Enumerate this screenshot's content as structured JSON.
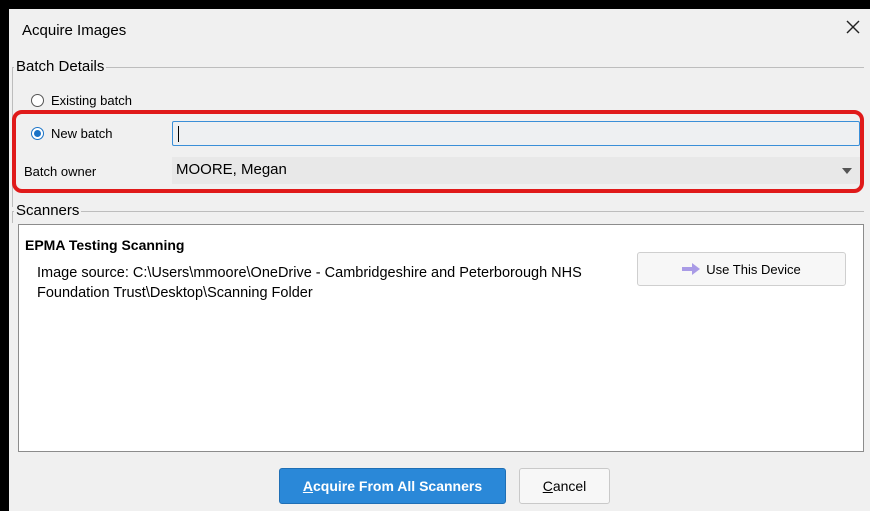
{
  "dialog": {
    "title": "Acquire Images",
    "close_icon": "close-icon"
  },
  "batch_details": {
    "group_label": "Batch Details",
    "existing_batch_label": "Existing batch",
    "existing_batch_selected": false,
    "new_batch_label": "New batch",
    "new_batch_selected": true,
    "new_batch_value": "",
    "batch_owner_label": "Batch owner",
    "batch_owner_value": "MOORE, Megan"
  },
  "scanners": {
    "group_label": "Scanners",
    "items": [
      {
        "name": "EPMA Testing Scanning",
        "source": "Image source: C:\\Users\\mmoore\\OneDrive - Cambridgeshire and Peterborough NHS Foundation Trust\\Desktop\\Scanning Folder",
        "use_button_label": "Use This Device",
        "use_button_icon": "arrow-right-icon"
      }
    ]
  },
  "footer": {
    "acquire_all_label": "Acquire From All Scanners",
    "cancel_label": "Cancel"
  },
  "colors": {
    "accent": "#2a88d8",
    "highlight": "#e01a1a",
    "arrow_icon": "#a99be6"
  }
}
